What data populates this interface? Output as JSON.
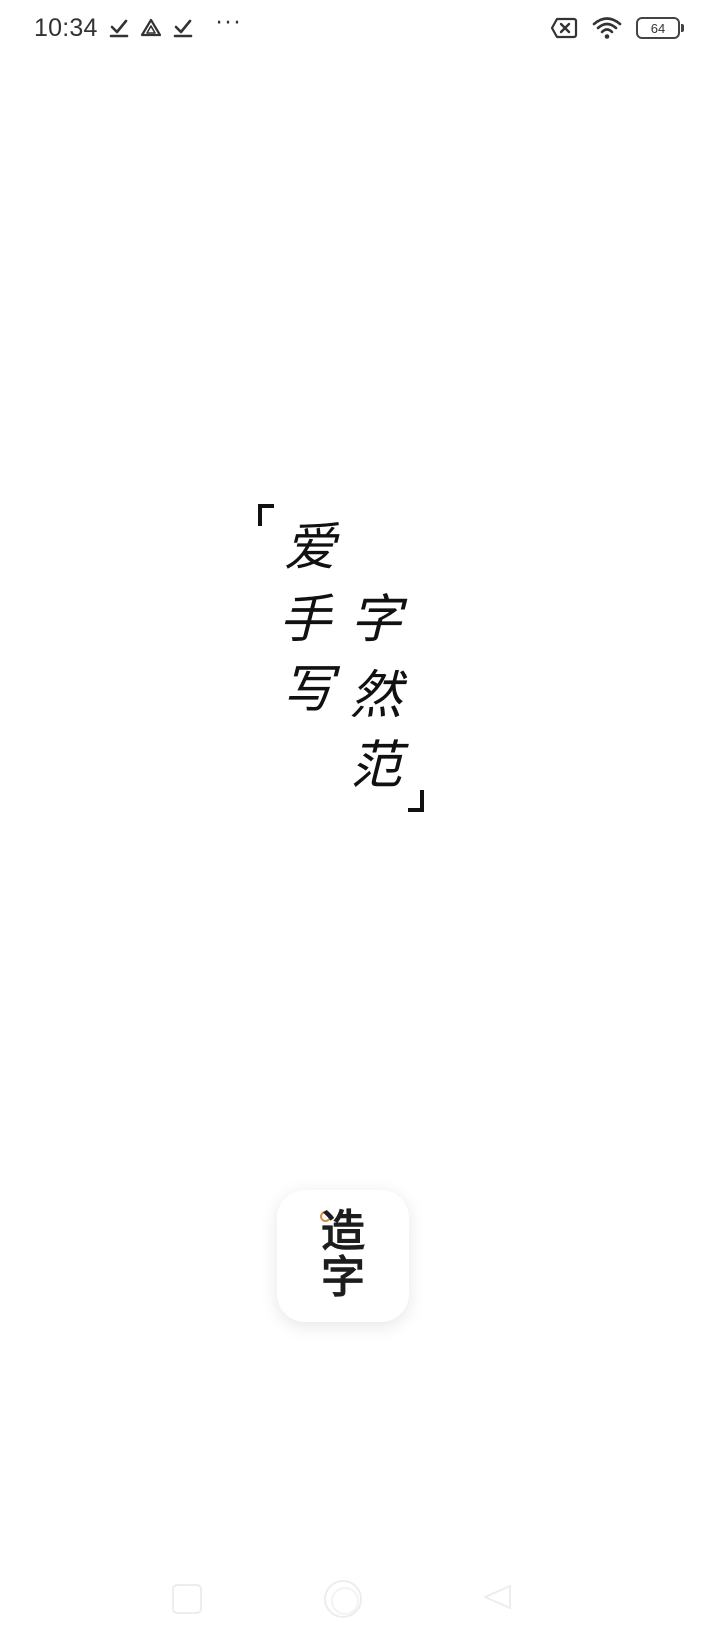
{
  "status_bar": {
    "time": "10:34",
    "icons_left": [
      "download-done-icon",
      "drive-icon",
      "download-done-icon",
      "more-dots-icon"
    ],
    "more": "···",
    "icons_right": [
      "sim-off-icon",
      "wifi-icon",
      "battery-icon"
    ],
    "battery_level": "64"
  },
  "splash": {
    "open_bracket": "「",
    "close_bracket": "」",
    "left_column": [
      "爱",
      "手",
      "写"
    ],
    "right_column": [
      "字",
      "然",
      "范"
    ]
  },
  "app_logo": {
    "line1": "造",
    "line2": "字",
    "accent_color": "#d98c3e"
  },
  "nav_bar": {
    "buttons": [
      "recents",
      "home",
      "back"
    ]
  }
}
